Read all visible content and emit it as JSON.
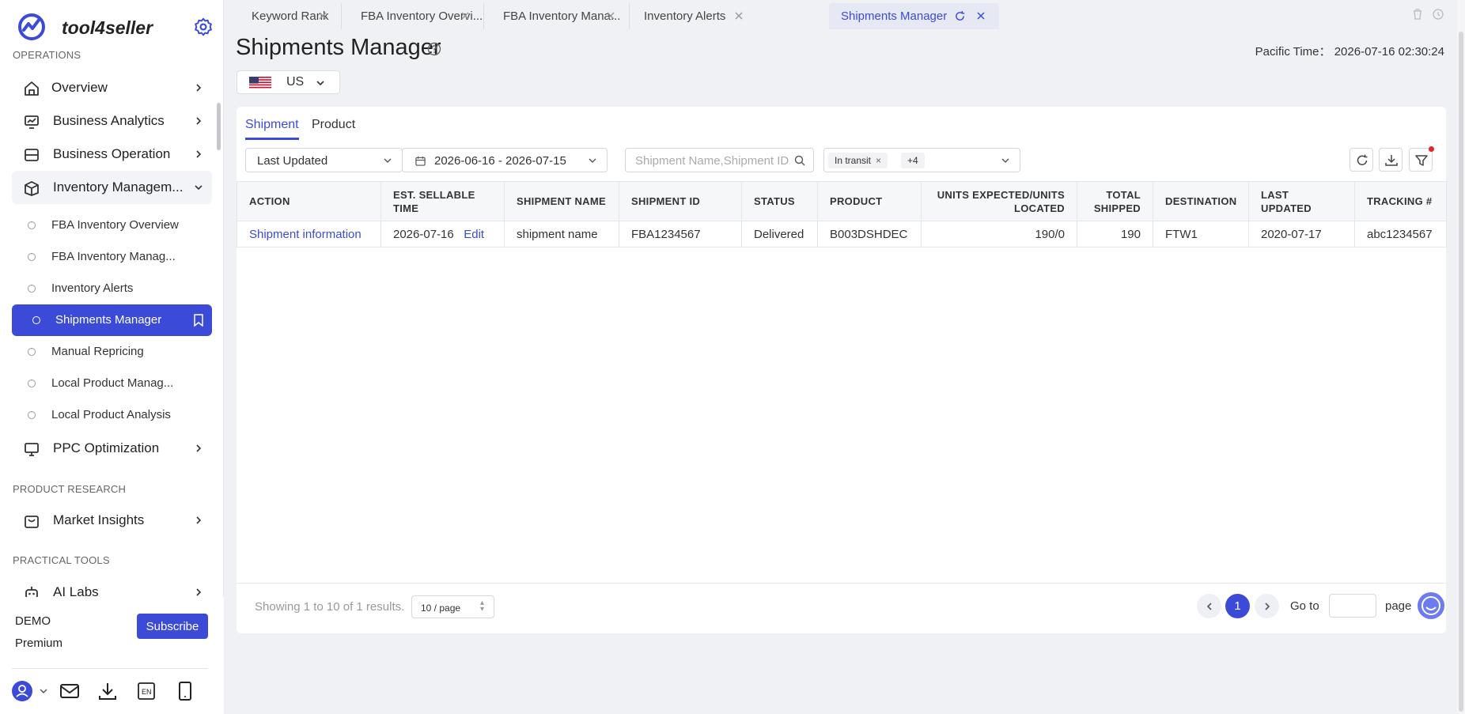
{
  "app": {
    "name": "tool4seller"
  },
  "sidebar": {
    "sections": {
      "operations": "OPERATIONS",
      "product_research": "PRODUCT RESEARCH",
      "practical_tools": "PRACTICAL TOOLS"
    },
    "items": [
      {
        "label": "Overview",
        "icon": "home-icon"
      },
      {
        "label": "Business Analytics",
        "icon": "analytics-icon"
      },
      {
        "label": "Business Operation",
        "icon": "operation-icon"
      },
      {
        "label": "Inventory Managem...",
        "icon": "box-icon"
      },
      {
        "label": "PPC Optimization",
        "icon": "monitor-icon"
      },
      {
        "label": "Market Insights",
        "icon": "bag-icon"
      },
      {
        "label": "AI Labs",
        "icon": "robot-icon"
      }
    ],
    "sub_items": [
      {
        "label": "FBA Inventory Overview"
      },
      {
        "label": "FBA Inventory Manag..."
      },
      {
        "label": "Inventory Alerts"
      },
      {
        "label": "Shipments Manager"
      },
      {
        "label": "Manual Repricing"
      },
      {
        "label": "Local Product Manag..."
      },
      {
        "label": "Local Product Analysis"
      }
    ],
    "account": {
      "plan_name": "DEMO",
      "plan_tier": "Premium",
      "subscribe_label": "Subscribe"
    }
  },
  "tabs": [
    {
      "label": "Keyword Rank"
    },
    {
      "label": "FBA Inventory Overvi..."
    },
    {
      "label": "FBA Inventory Mana..."
    },
    {
      "label": "Inventory Alerts"
    },
    {
      "label": "Shipments Manager"
    }
  ],
  "header": {
    "title": "Shipments Manager",
    "time_label": "Pacific Time：",
    "time_value": "2026-07-16 02:30:24",
    "country": "US"
  },
  "panel": {
    "tabs": [
      "Shipment",
      "Product"
    ],
    "filters": {
      "sort_field": "Last Updated",
      "date_range": "2026-06-16 - 2026-07-15",
      "search_placeholder": "Shipment Name,Shipment ID,",
      "status_tag": "In transit",
      "more_tags": "+4"
    },
    "table": {
      "headers": [
        "ACTION",
        "EST. SELLABLE TIME",
        "SHIPMENT NAME",
        "SHIPMENT ID",
        "STATUS",
        "PRODUCT",
        "UNITS EXPECTED/UNITS LOCATED",
        "TOTAL SHIPPED",
        "DESTINATION",
        "LAST UPDATED",
        "TRACKING #"
      ],
      "rows": [
        {
          "action": "Shipment information",
          "est_time": "2026-07-16",
          "edit": "Edit",
          "name": "shipment name",
          "id": "FBA1234567",
          "status": "Delivered",
          "product": "B003DSHDEC",
          "units": "190/0",
          "total": "190",
          "destination": "FTW1",
          "updated": "2020-07-17",
          "tracking": "abc1234567"
        }
      ]
    },
    "pagination": {
      "showing": "Showing 1 to 10 of 1 results.",
      "per_page": "10 / page",
      "current_page": "1",
      "goto_label": "Go to",
      "page_label": "page"
    }
  },
  "colors": {
    "accent": "#3b4bd8",
    "alert": "#e3242b"
  }
}
